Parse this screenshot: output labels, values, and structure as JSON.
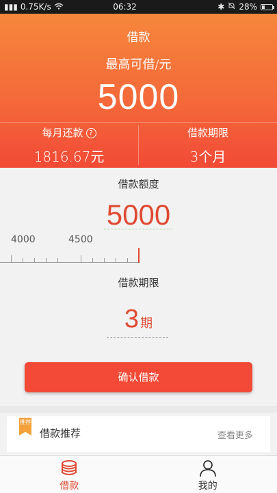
{
  "status_bar": {
    "network_speed": "0.75K/s",
    "time": "06:32",
    "battery": "28%",
    "battery_level": 0.28
  },
  "header": {
    "title": "借款",
    "max_label": "最高可借/元",
    "max_amount": "5000",
    "monthly_label": "每月还款",
    "monthly_help": "?",
    "monthly_value": "1816.67元",
    "period_label": "借款期限",
    "period_value": "3个月"
  },
  "amount": {
    "label": "借款额度",
    "value": "5000",
    "ruler_labels": [
      "4000",
      "4500"
    ]
  },
  "period": {
    "label": "借款期限",
    "value": "3",
    "unit": "期"
  },
  "confirm_button": "确认借款",
  "recommend": {
    "tag": "推荐",
    "title": "借款推荐",
    "more": "查看更多"
  },
  "nav": {
    "loan": "借款",
    "mine": "我的"
  },
  "colors": {
    "accent": "#f24a36",
    "amount_text": "#e04a32"
  }
}
